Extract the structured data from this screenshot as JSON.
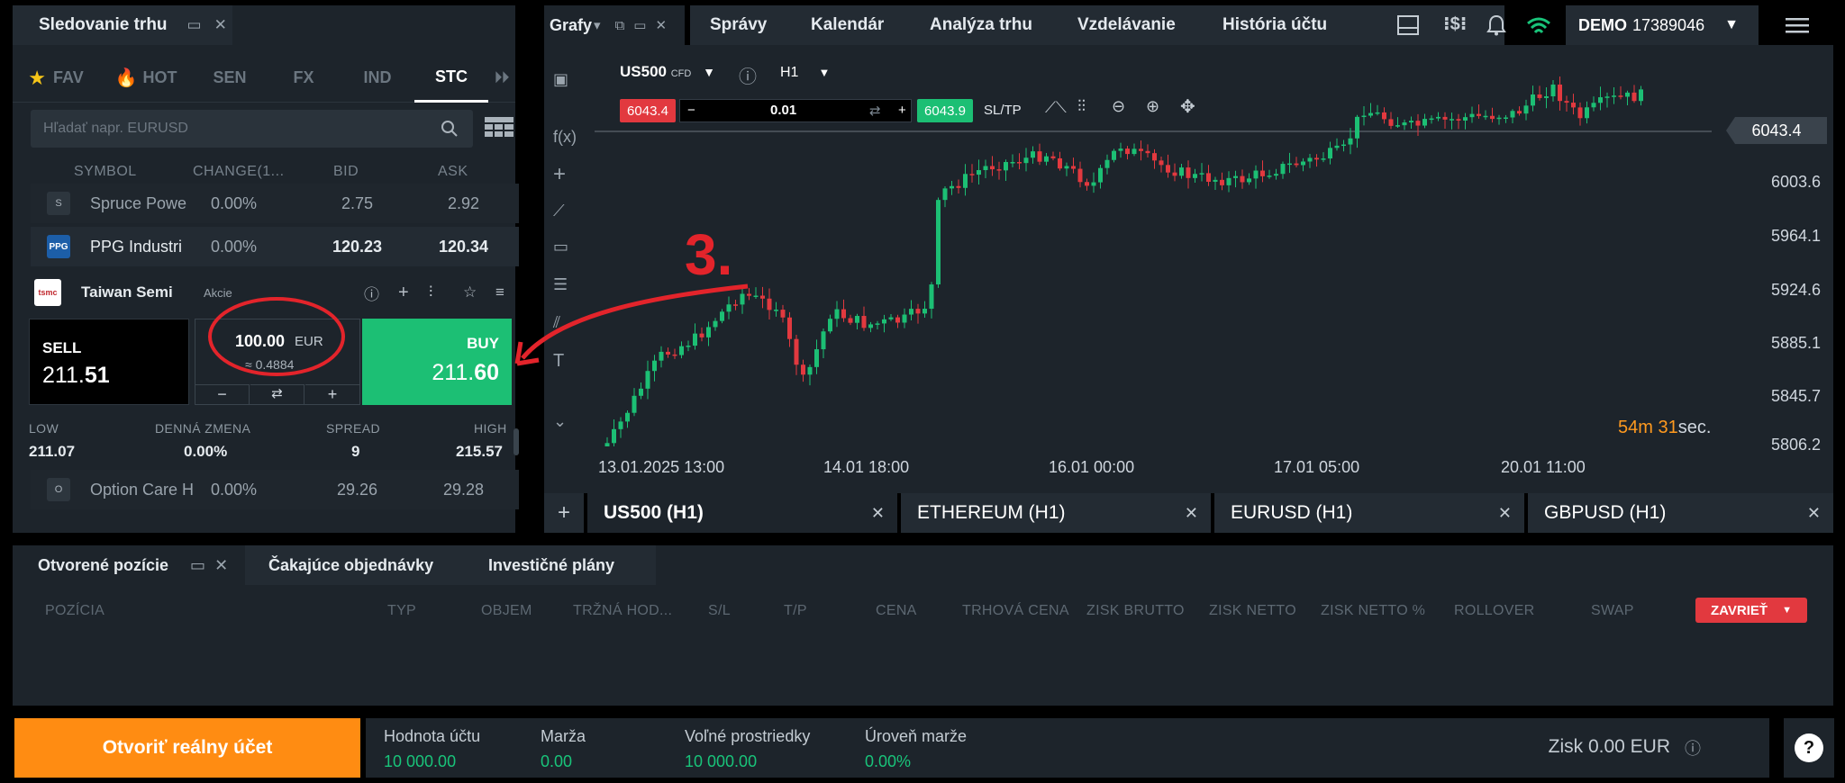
{
  "watchlist": {
    "title": "Sledovanie trhu",
    "categories": [
      "FAV",
      "HOT",
      "SEN",
      "FX",
      "IND",
      "STC"
    ],
    "search_placeholder": "Hľadať napr. EURUSD",
    "columns": [
      "SYMBOL",
      "CHANGE(1...",
      "BID",
      "ASK"
    ],
    "rows": [
      {
        "logo": "S",
        "symbol": "Spruce Powe",
        "change": "0.00%",
        "bid": "2.75",
        "ask": "2.92"
      },
      {
        "logo": "PPG",
        "symbol": "PPG Industri",
        "change": "0.00%",
        "bid": "120.23",
        "ask": "120.34"
      },
      {
        "logo": "O",
        "symbol": "Option Care H",
        "change": "0.00%",
        "bid": "29.26",
        "ask": "29.28"
      }
    ],
    "selected": {
      "name": "Taiwan Semi",
      "type": "Akcie",
      "sell_label": "SELL",
      "sell_price_main": "211.",
      "sell_price_big": "51",
      "buy_label": "BUY",
      "buy_price_main": "211.",
      "buy_price_big": "60",
      "amount": "100.00",
      "currency": "EUR",
      "approx": "≈ 0.4884",
      "minus": "−",
      "plus": "+"
    },
    "stats": [
      {
        "label": "LOW",
        "value": "211.07"
      },
      {
        "label": "DENNÁ ZMENA",
        "value": "0.00%"
      },
      {
        "label": "SPREAD",
        "value": "9"
      },
      {
        "label": "HIGH",
        "value": "215.57"
      }
    ]
  },
  "annotation": {
    "text": "3.",
    "color": "#e3242b"
  },
  "chart": {
    "tab_label": "Grafy",
    "nav": [
      "Správy",
      "Kalendár",
      "Analýza trhu",
      "Vzdelávanie",
      "História účtu"
    ],
    "account_mode": "DEMO",
    "account_id": "17389046",
    "symbol": "US500",
    "symbol_badge": "CFD",
    "timeframe": "H1",
    "sell": "6043.4",
    "buy": "6043.9",
    "lot": "0.01",
    "sltp": "SL/TP",
    "current_price": "6043.4",
    "y_labels": [
      "6003.6",
      "5964.1",
      "5924.6",
      "5885.1",
      "5845.7",
      "5806.2"
    ],
    "x_labels": [
      "13.01.2025 13:00",
      "14.01 18:00",
      "16.01 00:00",
      "17.01 05:00",
      "20.01 11:00"
    ],
    "timer_min": "54",
    "timer_min_unit": "m",
    "timer_sec": "31",
    "timer_sec_unit": "sec.",
    "up_color": "#1cbf74",
    "down_color": "#e2393f",
    "bottom_tabs": [
      "US500 (H1)",
      "ETHEREUM (H1)",
      "EURUSD (H1)",
      "GBPUSD (H1)"
    ]
  },
  "positions": {
    "tabs": [
      "Otvorené pozície",
      "Čakajúce objednávky",
      "Investičné plány"
    ],
    "columns": [
      "POZÍCIA",
      "TYP",
      "OBJEM",
      "TRŽNÁ HOD...",
      "S/L",
      "T/P",
      "CENA",
      "TRHOVÁ CENA",
      "ZISK BRUTTO",
      "ZISK NETTO",
      "ZISK NETTO %",
      "ROLLOVER",
      "SWAP"
    ],
    "close_button": "ZAVRIEŤ"
  },
  "footer": {
    "real_account": "Otvoriť reálny účet",
    "fields": [
      {
        "label": "Hodnota účtu",
        "value": "10 000.00"
      },
      {
        "label": "Marža",
        "value": "0.00"
      },
      {
        "label": "Voľné prostriedky",
        "value": "10 000.00"
      },
      {
        "label": "Úroveň marže",
        "value": "0.00%"
      }
    ],
    "profit": "Zisk 0.00 EUR",
    "help": "?"
  }
}
